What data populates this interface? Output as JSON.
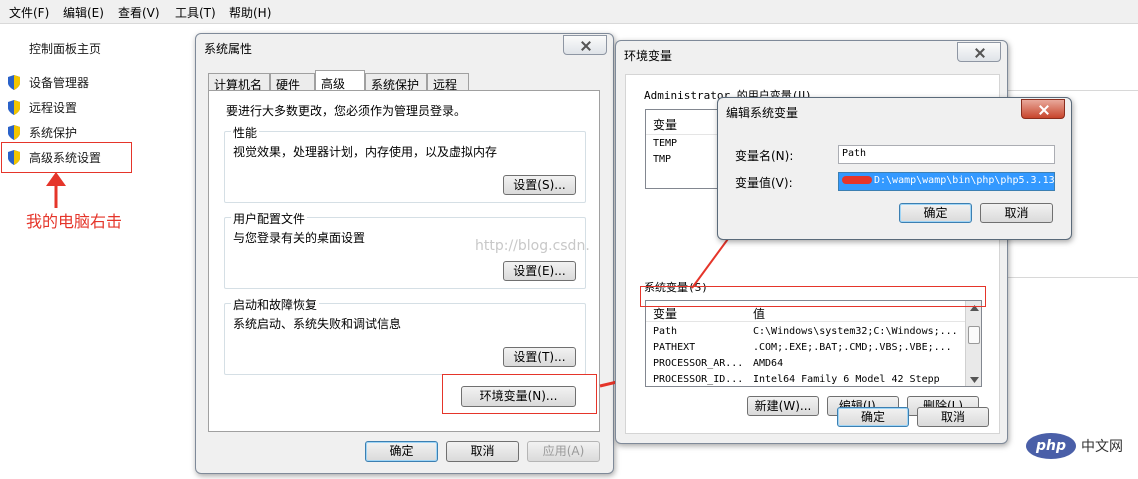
{
  "menu": [
    "文件(F)",
    "编辑(E)",
    "查看(V)",
    "工具(T)",
    "帮助(H)"
  ],
  "control_panel": {
    "home": "控制面板主页",
    "items": [
      "设备管理器",
      "远程设置",
      "系统保护",
      "高级系统设置"
    ]
  },
  "annotation": {
    "text": "我的电脑右击",
    "color": "#e5352a"
  },
  "system_properties": {
    "title": "系统属性",
    "tabs": [
      "计算机名",
      "硬件",
      "高级",
      "系统保护",
      "远程"
    ],
    "admin_note": "要进行大多数更改，您必须作为管理员登录。",
    "groups": [
      {
        "title": "性能",
        "desc": "视觉效果，处理器计划，内存使用，以及虚拟内存",
        "button": "设置(S)..."
      },
      {
        "title": "用户配置文件",
        "desc": "与您登录有关的桌面设置",
        "button": "设置(E)..."
      },
      {
        "title": "启动和故障恢复",
        "desc": "系统启动、系统失败和调试信息",
        "button": "设置(T)..."
      }
    ],
    "env_button": "环境变量(N)...",
    "ok": "确定",
    "cancel": "取消",
    "apply": "应用(A)"
  },
  "env_vars": {
    "title": "环境变量",
    "user_label": "Administrator 的用户变量(U)",
    "user_header": "变量",
    "user_rows": [
      "TEMP",
      "TMP"
    ],
    "sys_label": "系统变量(S)",
    "sys_headers": [
      "变量",
      "值"
    ],
    "sys_rows": [
      {
        "name": "Path",
        "value": "C:\\Windows\\system32;C:\\Windows;..."
      },
      {
        "name": "PATHEXT",
        "value": ".COM;.EXE;.BAT;.CMD;.VBS;.VBE;..."
      },
      {
        "name": "PROCESSOR_AR...",
        "value": "AMD64"
      },
      {
        "name": "PROCESSOR_ID...",
        "value": "Intel64 Family 6 Model 42 Stepp"
      }
    ],
    "new_btn": "新建(W)...",
    "edit_btn": "编辑(I)...",
    "delete_btn": "删除(L)",
    "ok": "确定",
    "cancel": "取消"
  },
  "edit_var": {
    "title": "编辑系统变量",
    "name_label": "变量名(N):",
    "name_value": "Path",
    "value_label": "变量值(V):",
    "value_value": "D:\\wamp\\wamp\\bin\\php\\php5.3.13",
    "ok": "确定",
    "cancel": "取消"
  },
  "watermark": "http://blog.csdn.",
  "php_badge": {
    "logo": "php",
    "site": "中文网",
    "color": "#4a5fa8"
  }
}
